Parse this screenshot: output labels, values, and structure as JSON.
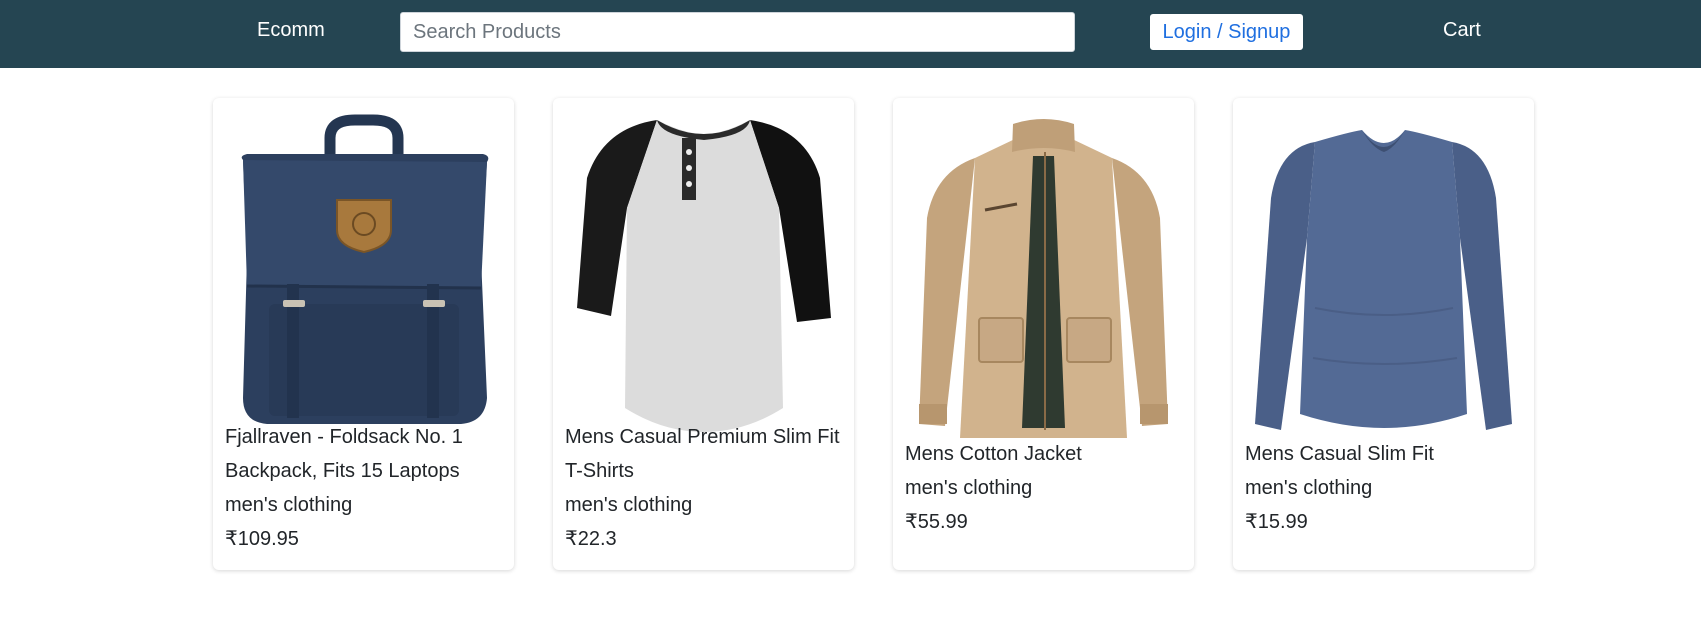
{
  "navbar": {
    "brand": "Ecomm",
    "search_placeholder": "Search Products",
    "search_value": "",
    "login_label": "Login / Signup",
    "cart_label": "Cart",
    "colors": {
      "background": "#254552",
      "link": "#1f6fe0"
    }
  },
  "products": [
    {
      "title": "Fjallraven - Foldsack No. 1 Backpack, Fits 15 Laptops",
      "category": "men's clothing",
      "price": "₹109.95",
      "image_icon": "backpack-image"
    },
    {
      "title": "Mens Casual Premium Slim Fit T-Shirts",
      "category": "men's clothing",
      "price": "₹22.3",
      "image_icon": "raglan-tshirt-image"
    },
    {
      "title": "Mens Cotton Jacket",
      "category": "men's clothing",
      "price": "₹55.99",
      "image_icon": "cotton-jacket-image"
    },
    {
      "title": "Mens Casual Slim Fit",
      "category": "men's clothing",
      "price": "₹15.99",
      "image_icon": "long-sleeve-shirt-image"
    }
  ]
}
